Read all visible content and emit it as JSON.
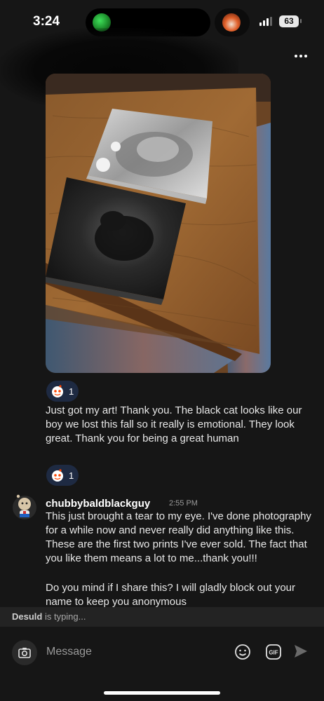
{
  "status_bar": {
    "time": "3:24",
    "battery": "63"
  },
  "messages": [
    {
      "reaction_count": "1"
    },
    {
      "text": "Just got my art! Thank you. The black cat looks like our boy we lost this fall so it really is emotional.  They look great. Thank you for being a great human",
      "reaction_count": "1"
    }
  ],
  "reply": {
    "username": "chubbybaldblackguy",
    "time": "2:55 PM",
    "text1": "This just brought a tear to my eye. I've done photography for a while now and never really did anything like this. These are the first two prints I've ever sold. The fact that you like them means a lot to me...thank you!!!",
    "text2": "Do you mind if I share this? I will gladly block out your name to keep you anonymous"
  },
  "typing": {
    "user": "Desuld",
    "suffix": " is typing..."
  },
  "composer": {
    "placeholder": "Message",
    "gif_label": "GIF"
  },
  "colors": {
    "background": "#161616",
    "reaction_pill": "#1e2a42",
    "typing_bar": "#232323"
  },
  "icons": [
    "more-icon",
    "reaction-icon",
    "camera-icon",
    "emoji-icon",
    "gif-icon",
    "send-icon"
  ]
}
